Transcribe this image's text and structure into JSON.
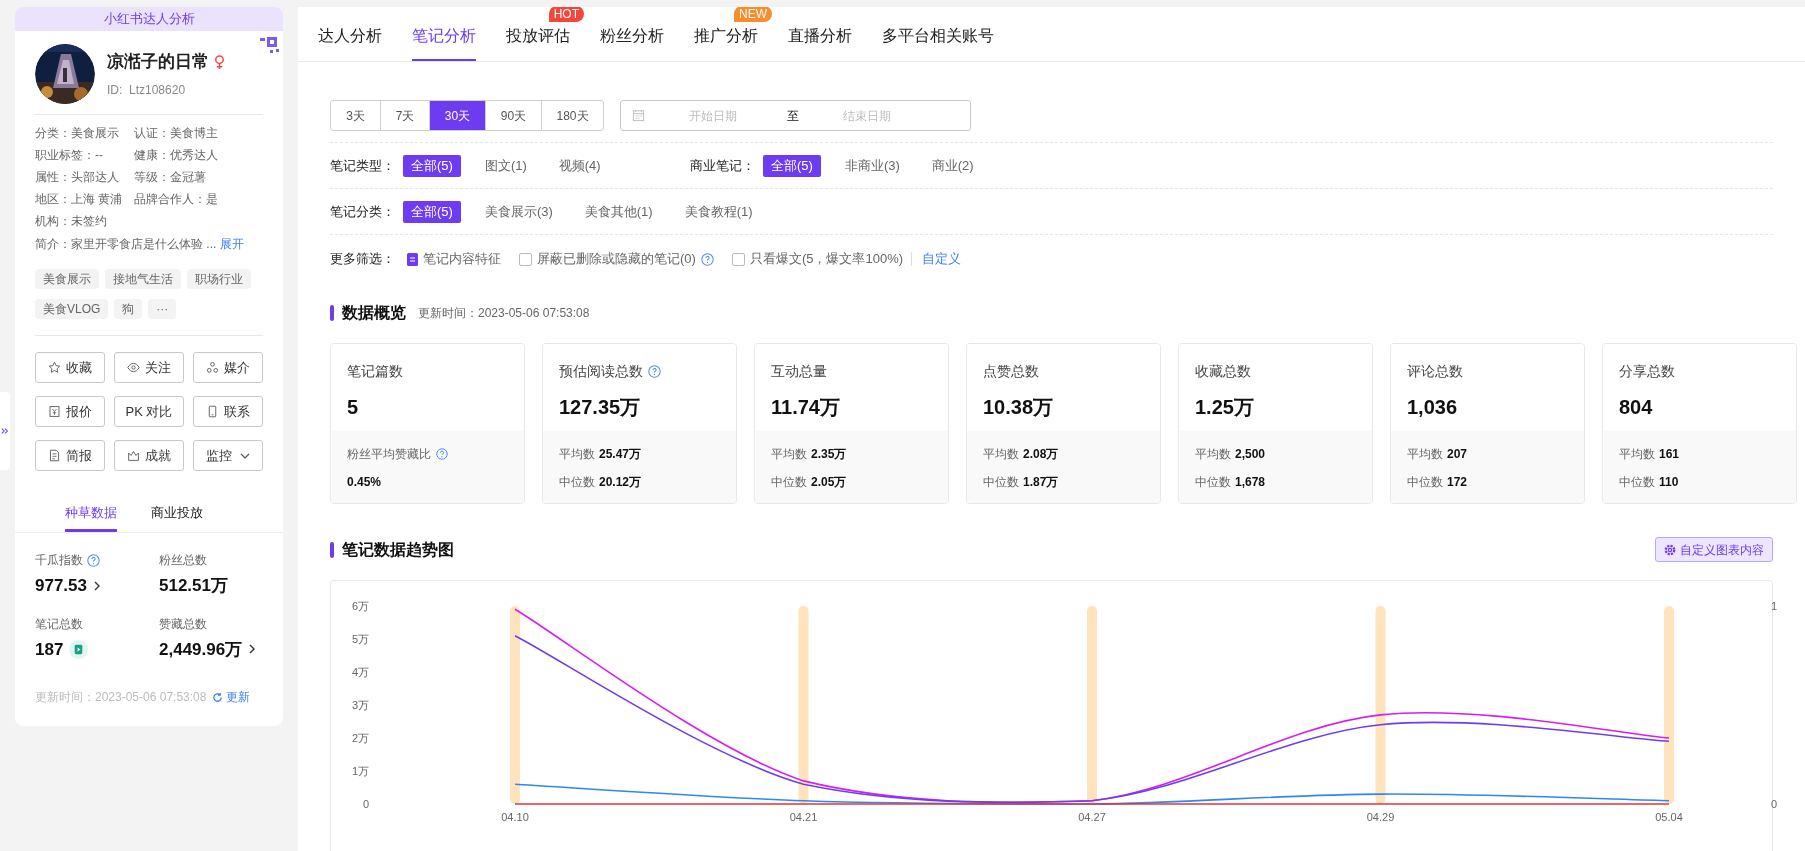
{
  "sidebar": {
    "header": "小红书达人分析",
    "profile": {
      "name": "凉湉子的日常",
      "id": "ID:  Ltz108620"
    },
    "info": [
      {
        "text": "分类：美食展示"
      },
      {
        "text": "认证：美食博主"
      },
      {
        "text": "职业标签：--"
      },
      {
        "text": "健康：优秀达人"
      },
      {
        "text": "属性：头部达人"
      },
      {
        "text": "等级：金冠薯"
      },
      {
        "text": "地区：上海 黄浦"
      },
      {
        "text": "品牌合作人：是"
      },
      {
        "text": "机构：未签约"
      }
    ],
    "intro": {
      "text": "简介：家里开零食店是什么体验 ...",
      "link": "展开"
    },
    "tags": [
      "美食展示",
      "接地气生活",
      "职场行业",
      "美食VLOG",
      "狗",
      "···"
    ],
    "actions": [
      {
        "label": "收藏",
        "kind": "button"
      },
      {
        "label": "关注",
        "kind": "button"
      },
      {
        "label": "媒介",
        "kind": "button"
      },
      {
        "label": "报价",
        "kind": "button"
      },
      {
        "label": "PK 对比",
        "kind": "button"
      },
      {
        "label": "联系",
        "kind": "button"
      },
      {
        "label": "简报",
        "kind": "button"
      },
      {
        "label": "成就",
        "kind": "button"
      },
      {
        "label": "监控",
        "kind": "dropdown"
      }
    ],
    "tabs": [
      {
        "label": "种草数据",
        "selected": true
      },
      {
        "label": "商业投放",
        "selected": false
      }
    ],
    "stats": [
      {
        "label": "千瓜指数",
        "value": "977.53",
        "help": true,
        "arrow": true,
        "badge": false
      },
      {
        "label": "粉丝总数",
        "value": "512.51万",
        "help": false,
        "arrow": false,
        "badge": false
      },
      {
        "label": "笔记总数",
        "value": "187",
        "help": false,
        "arrow": false,
        "badge": true
      },
      {
        "label": "赞藏总数",
        "value": "2,449.96万",
        "help": false,
        "arrow": true,
        "badge": false
      }
    ],
    "updated": {
      "text": "更新时间：2023-05-06 07:53:08",
      "action": "更新"
    }
  },
  "main": {
    "nav_tabs": [
      {
        "label": "达人分析",
        "selected": false
      },
      {
        "label": "笔记分析",
        "selected": true
      },
      {
        "label": "投放评估",
        "selected": false,
        "badge": "HOT",
        "color": "#f5463a"
      },
      {
        "label": "粉丝分析",
        "selected": false
      },
      {
        "label": "推广分析",
        "selected": false,
        "badge": "NEW",
        "color": "#fb8c2a"
      },
      {
        "label": "直播分析",
        "selected": false
      },
      {
        "label": "多平台相关账号",
        "selected": false
      }
    ],
    "periods": [
      {
        "label": "3天",
        "selected": false
      },
      {
        "label": "7天",
        "selected": false
      },
      {
        "label": "30天",
        "selected": true
      },
      {
        "label": "90天",
        "selected": false
      },
      {
        "label": "180天",
        "selected": false
      }
    ],
    "date_range": {
      "start_placeholder": "开始日期",
      "separator": "至",
      "end_placeholder": "结束日期"
    },
    "filter_rows": [
      {
        "groups": [
          {
            "label": "笔记类型：",
            "options": [
              {
                "label": "全部(5)",
                "selected": true
              },
              {
                "label": "图文(1)",
                "selected": false
              },
              {
                "label": "视频(4)",
                "selected": false
              }
            ]
          },
          {
            "label": "商业笔记：",
            "options": [
              {
                "label": "全部(5)",
                "selected": true
              },
              {
                "label": "非商业(3)",
                "selected": false
              },
              {
                "label": "商业(2)",
                "selected": false
              }
            ]
          }
        ]
      },
      {
        "groups": [
          {
            "label": "笔记分类：",
            "options": [
              {
                "label": "全部(5)",
                "selected": true
              },
              {
                "label": "美食展示(3)",
                "selected": false
              },
              {
                "label": "美食其他(1)",
                "selected": false
              },
              {
                "label": "美食教程(1)",
                "selected": false
              }
            ]
          }
        ]
      }
    ],
    "more_filters": {
      "label": "更多筛选：",
      "items": [
        {
          "kind": "feature",
          "label": "笔记内容特征"
        },
        {
          "kind": "checkbox",
          "label": "屏蔽已删除或隐藏的笔记(0)",
          "checked": false,
          "help": true
        },
        {
          "kind": "checkbox",
          "label": "只看爆文(5，爆文率100%)",
          "checked": false,
          "help": false
        }
      ],
      "link": "自定义"
    },
    "overview": {
      "title": "数据概览",
      "updated": "更新时间：2023-05-06 07:53:08",
      "cards": [
        {
          "label": "笔记篇数",
          "value": "5",
          "help": false,
          "kind": "ratio",
          "sub_label": "粉丝平均赞藏比",
          "sub_value": "0.45%"
        },
        {
          "label": "预估阅读总数",
          "value": "127.35万",
          "help": true,
          "kind": "stats",
          "details": [
            {
              "label": "平均数",
              "value": "25.47万"
            },
            {
              "label": "中位数",
              "value": "20.12万"
            }
          ]
        },
        {
          "label": "互动总量",
          "value": "11.74万",
          "help": false,
          "kind": "stats",
          "details": [
            {
              "label": "平均数",
              "value": "2.35万"
            },
            {
              "label": "中位数",
              "value": "2.05万"
            }
          ]
        },
        {
          "label": "点赞总数",
          "value": "10.38万",
          "help": false,
          "kind": "stats",
          "details": [
            {
              "label": "平均数",
              "value": "2.08万"
            },
            {
              "label": "中位数",
              "value": "1.87万"
            }
          ]
        },
        {
          "label": "收藏总数",
          "value": "1.25万",
          "help": false,
          "kind": "stats",
          "details": [
            {
              "label": "平均数",
              "value": "2,500"
            },
            {
              "label": "中位数",
              "value": "1,678"
            }
          ]
        },
        {
          "label": "评论总数",
          "value": "1,036",
          "help": false,
          "kind": "stats",
          "details": [
            {
              "label": "平均数",
              "value": "207"
            },
            {
              "label": "中位数",
              "value": "172"
            }
          ]
        },
        {
          "label": "分享总数",
          "value": "804",
          "help": false,
          "kind": "stats",
          "details": [
            {
              "label": "平均数",
              "value": "161"
            },
            {
              "label": "中位数",
              "value": "110"
            }
          ]
        }
      ]
    },
    "trend": {
      "title": "笔记数据趋势图",
      "button": "自定义图表内容",
      "chart_data": {
        "type": "line",
        "categories": [
          "04.10",
          "04.21",
          "04.27",
          "04.29",
          "05.04"
        ],
        "ylim": [
          0,
          6
        ],
        "yticks": [
          {
            "value": 0,
            "label": "0"
          },
          {
            "value": 1,
            "label": "1万"
          },
          {
            "value": 2,
            "label": "2万"
          },
          {
            "value": 3,
            "label": "3万"
          },
          {
            "value": 4,
            "label": "4万"
          },
          {
            "value": 5,
            "label": "5万"
          },
          {
            "value": 6,
            "label": "6万"
          }
        ],
        "y2lim": [
          0,
          1
        ],
        "y2ticks": [
          0,
          1
        ],
        "series": [
          {
            "type": "bar",
            "axis": "y2",
            "color": "#ffe3bd",
            "values": [
              1,
              1,
              1,
              1,
              1
            ]
          },
          {
            "color": "#d41ef0",
            "values": [
              5.9,
              0.7,
              0.1,
              2.7,
              2.0
            ]
          },
          {
            "color": "#6e3cf0",
            "values": [
              5.1,
              0.6,
              0.1,
              2.4,
              1.9
            ]
          },
          {
            "color": "#2f86f6",
            "values": [
              0.6,
              0.1,
              0,
              0.3,
              0.1
            ]
          },
          {
            "color": "#e2333a",
            "values": [
              0,
              0,
              0,
              0,
              0
            ]
          }
        ]
      }
    }
  }
}
